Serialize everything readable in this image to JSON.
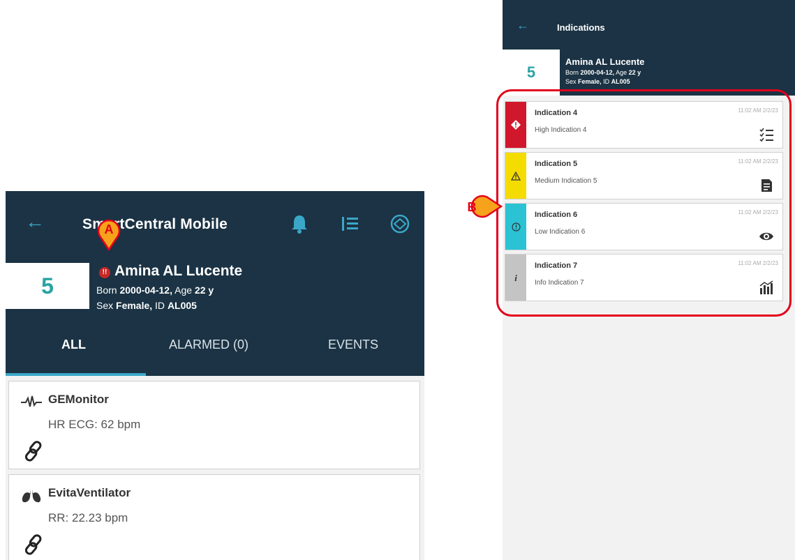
{
  "left_screen": {
    "title": "SmartCentral Mobile",
    "bed": "5",
    "patient_name": "Amina AL Lucente",
    "born_label": "Born",
    "born_value": "2000-04-12,",
    "age_label": "Age",
    "age_value": "22 y",
    "sex_label": "Sex",
    "sex_value": "Female,",
    "id_label": "ID",
    "id_value": "AL005",
    "tabs": [
      {
        "label": "ALL"
      },
      {
        "label": "ALARMED (0)"
      },
      {
        "label": "EVENTS"
      }
    ],
    "devices": [
      {
        "name": "GEMonitor",
        "value": "HR ECG: 62 bpm",
        "icon": "ecg-wave-icon"
      },
      {
        "name": "EvitaVentilator",
        "value": "RR: 22.23 bpm",
        "icon": "lungs-icon"
      }
    ]
  },
  "right_screen": {
    "title": "Indications",
    "bed": "5",
    "patient_name": "Amina AL Lucente",
    "born_label": "Born",
    "born_value": "2000-04-12,",
    "age_label": "Age",
    "age_value": "22 y",
    "sex_label": "Sex",
    "sex_value": "Female,",
    "id_label": "ID",
    "id_value": "AL005",
    "indications": [
      {
        "name": "Indication 4",
        "text": "High Indication 4",
        "time": "11:02 AM 2/2/23",
        "level": "high",
        "color": "#d1172c",
        "action_icon": "checklist-icon"
      },
      {
        "name": "Indication 5",
        "text": "Medium Indication 5",
        "time": "11:02 AM 2/2/23",
        "level": "medium",
        "color": "#f5dc00",
        "action_icon": "document-icon"
      },
      {
        "name": "Indication 6",
        "text": "Low Indication 6",
        "time": "11:02 AM 2/2/23",
        "level": "low",
        "color": "#2bc3d4",
        "action_icon": "eye-icon"
      },
      {
        "name": "Indication 7",
        "text": "Info Indication 7",
        "time": "11:02 AM 2/2/23",
        "level": "info",
        "color": "#c4c4c4",
        "action_icon": "bar-chart-icon"
      }
    ]
  },
  "annotations": {
    "marker_a": "A",
    "marker_b": "B",
    "marker_color": "#e3001b",
    "marker_fill": "#f6a21a"
  },
  "colors": {
    "header_bg": "#1b3344",
    "accent": "#3aa7c9",
    "bed_number": "#2aa3a4"
  }
}
